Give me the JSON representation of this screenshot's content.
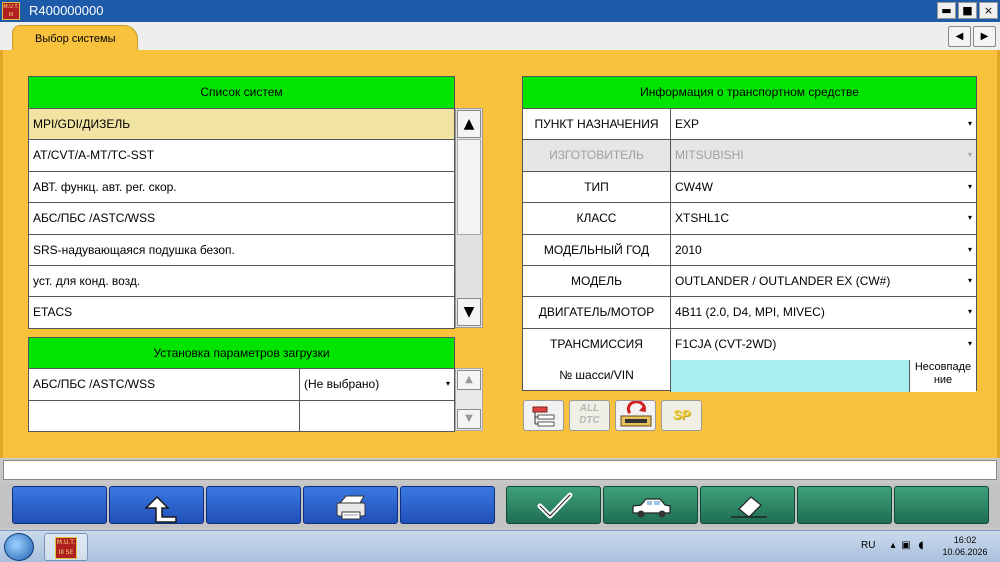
{
  "window": {
    "title": "R400000000",
    "logo_text": "M.U.T. III",
    "minimize_glyph": "▬",
    "maximize_glyph": "■",
    "close_glyph": "×"
  },
  "tab": {
    "label": "Выбор системы"
  },
  "nav": {
    "back_glyph": "◀",
    "forward_glyph": "▶"
  },
  "system_list": {
    "header": "Список систем",
    "items": [
      "MPI/GDI/ДИЗЕЛЬ",
      "AT/CVT/A-MT/TC-SST",
      "АВТ. функц. авт. рег. скор.",
      "АБС/ПБС /ASTC/WSS",
      "SRS-надувающаяся подушка безоп.",
      "уст. для конд. возд.",
      "ETACS"
    ],
    "selected_index": 0,
    "scroll_up_glyph": "▲",
    "scroll_down_glyph": "▼"
  },
  "load_params": {
    "header": "Установка параметров загрузки",
    "rows": [
      {
        "system": "АБС/ПБС /ASTC/WSS",
        "value": "(Не выбрано)"
      },
      {
        "system": "",
        "value": ""
      }
    ],
    "dropdown_glyph": "▾",
    "scroll_up_glyph": "▲",
    "scroll_down_glyph": "▼"
  },
  "vehicle_info": {
    "header": "Информация о транспортном средстве",
    "rows": [
      {
        "label": "ПУНКТ НАЗНАЧЕНИЯ",
        "value": "EXP",
        "disabled": false
      },
      {
        "label": "ИЗГОТОВИТЕЛЬ",
        "value": "MITSUBISHI",
        "disabled": true
      },
      {
        "label": "ТИП",
        "value": "CW4W",
        "disabled": false
      },
      {
        "label": "КЛАСС",
        "value": "XTSHL1C",
        "disabled": false
      },
      {
        "label": "МОДЕЛЬНЫЙ ГОД",
        "value": "2010",
        "disabled": false
      },
      {
        "label": "МОДЕЛЬ",
        "value": "OUTLANDER / OUTLANDER EX (CW#)",
        "disabled": false
      },
      {
        "label": "ДВИГАТЕЛЬ/МОТОР",
        "value": "4B11 (2.0, D4, MPI, MIVEC)",
        "disabled": false
      },
      {
        "label": "ТРАНСМИССИЯ",
        "value": "F1CJA (CVT-2WD)",
        "disabled": false
      }
    ],
    "vin_label": "№ шасси/VIN",
    "vin_value": "",
    "vin_status_line1": "Несовпаде",
    "vin_status_line2": "ние",
    "dropdown_glyph": "▾"
  },
  "tool_icons": [
    {
      "name": "system-tree-icon"
    },
    {
      "name": "all-dtc-icon",
      "line1": "ALL",
      "line2": "DTC"
    },
    {
      "name": "ecu-refresh-icon"
    },
    {
      "name": "sp-icon",
      "label": "SP"
    }
  ],
  "function_buttons": [
    {
      "name": "func-button-1",
      "icon": ""
    },
    {
      "name": "func-button-up",
      "icon": "up-arrow-icon"
    },
    {
      "name": "func-button-3",
      "icon": ""
    },
    {
      "name": "func-button-print",
      "icon": "printer-icon"
    },
    {
      "name": "func-button-5",
      "icon": ""
    },
    {
      "name": "func-button-ok",
      "icon": "checkmark-icon"
    },
    {
      "name": "func-button-vehicle",
      "icon": "car-icon"
    },
    {
      "name": "func-button-erase",
      "icon": "eraser-icon"
    },
    {
      "name": "func-button-9",
      "icon": ""
    },
    {
      "name": "func-button-10",
      "icon": ""
    }
  ],
  "taskbar": {
    "task_label": "M.U.T. III SE",
    "language": "RU",
    "time": "16:02",
    "date": "10.06.2026"
  },
  "colors": {
    "workspace": "#f9c23c",
    "panel_header": "#00e400",
    "selected_row": "#f1e4a3",
    "vin_field": "#a8eeee",
    "titlebar": "#1d5aa8",
    "function_button_blue": "#2f66d0",
    "function_button_green": "#2e8a66"
  }
}
